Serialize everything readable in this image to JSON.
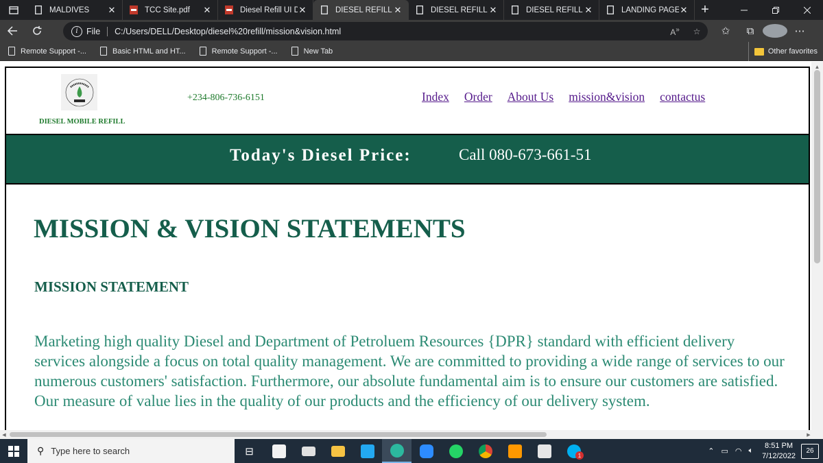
{
  "browser": {
    "tabs": [
      {
        "title": "MALDIVES",
        "icon": "document-icon",
        "active": false
      },
      {
        "title": "TCC Site.pdf",
        "icon": "pdf-icon",
        "active": false
      },
      {
        "title": "Diesel Refill UI De",
        "icon": "pdf-icon",
        "active": false
      },
      {
        "title": "DIESEL REFILL",
        "icon": "document-icon",
        "active": true
      },
      {
        "title": "DIESEL REFILL",
        "icon": "document-icon",
        "active": false
      },
      {
        "title": "DIESEL REFILL",
        "icon": "document-icon",
        "active": false
      },
      {
        "title": "LANDING PAGE",
        "icon": "document-icon",
        "active": false
      }
    ],
    "close_glyph": "✕",
    "new_tab_glyph": "+",
    "address": {
      "scheme_label": "File",
      "url": "C:/Users/DELL/Desktop/diesel%20refill/mission&vision.html"
    },
    "bookmarks": [
      {
        "label": "Remote Support -..."
      },
      {
        "label": "Basic HTML and HT..."
      },
      {
        "label": "Remote Support -..."
      },
      {
        "label": "New Tab"
      }
    ],
    "other_favorites": "Other favorites"
  },
  "site": {
    "logo_text": "DIESEL REFILL",
    "logo_subtext": "KING-DIEL",
    "brand_name": "DIESEL MOBILE REFILL",
    "phone": "+234-806-736-6151",
    "nav": [
      {
        "label": "Index"
      },
      {
        "label": "Order"
      },
      {
        "label": "About Us"
      },
      {
        "label": "mission&vision"
      },
      {
        "label": "contactus"
      }
    ],
    "price_label": "Today's Diesel Price:",
    "price_call": "Call 080-673-661-51",
    "page_title": "MISSION & VISION STATEMENTS",
    "mission_heading": "MISSION STATEMENT",
    "mission_text": "Marketing high quality Diesel and Department of Petroluem Resources {DPR} standard with efficient delivery services alongside a focus on total quality management. We are committed to providing a wide range of services to our numerous customers' satisfaction. Furthermore, our absolute fundamental aim is to ensure our customers are satisfied. Our measure of value lies in the quality of our products and the efficiency of our delivery system."
  },
  "colors": {
    "brand_green": "#155e4b",
    "text_green": "#2b8a73",
    "phone_green": "#1e7a2c",
    "link_purple": "#551a8b"
  },
  "taskbar": {
    "search_placeholder": "Type here to search",
    "apps": [
      "task-view-icon",
      "store-icon",
      "mail-icon",
      "file-explorer-icon",
      "vscode-icon",
      "edge-icon",
      "zoom-icon",
      "whatsapp-icon",
      "chrome-icon",
      "sublime-icon",
      "photos-icon",
      "skype-icon"
    ],
    "skype_badge": "1",
    "time": "8:51 PM",
    "date": "7/12/2022",
    "notification_count": "26"
  }
}
